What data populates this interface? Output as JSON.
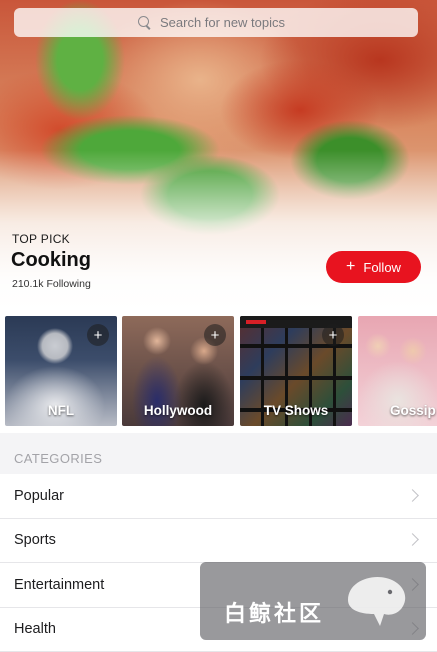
{
  "search": {
    "placeholder": "Search for new topics"
  },
  "hero": {
    "eyebrow": "TOP PICK",
    "title": "Cooking",
    "followers": "210.1k Following",
    "follow_label": "Follow",
    "follow_icon": "plus-icon",
    "accent_color": "#e8131f"
  },
  "topics": [
    {
      "label": "NFL",
      "add_icon": "plus-icon"
    },
    {
      "label": "Hollywood",
      "add_icon": "plus-icon"
    },
    {
      "label": "TV Shows",
      "add_icon": "plus-icon"
    },
    {
      "label": "Gossip"
    }
  ],
  "categories": {
    "header": "CATEGORIES",
    "items": [
      "Popular",
      "Sports",
      "Entertainment",
      "Health"
    ],
    "chevron_icon": "chevron-right-icon"
  },
  "watermark": {
    "text": "白鲸社区"
  }
}
